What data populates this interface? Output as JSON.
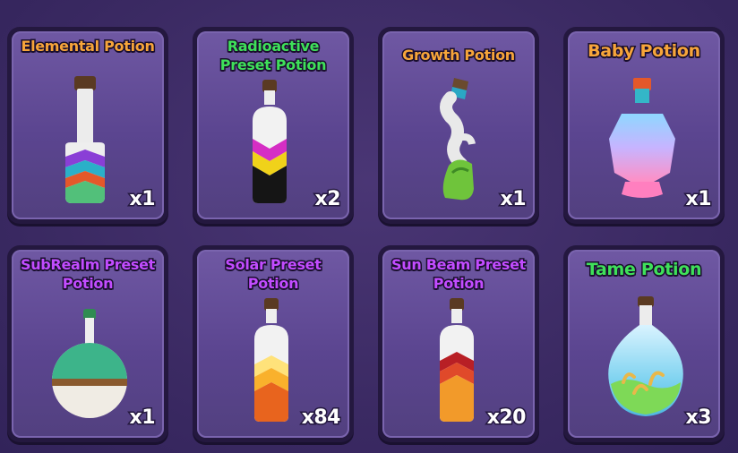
{
  "colors": {
    "panel_bg": "#3b2a63",
    "card_bg": "#5b4590",
    "name_orange": "#f7a53a",
    "name_green": "#3fe05a",
    "name_purple": "#c24cff"
  },
  "inventory": {
    "items": [
      {
        "name": "Elemental Potion",
        "quantity": "x1",
        "name_color": "#f7a53a",
        "icon": "elemental-potion-icon"
      },
      {
        "name": "Radioactive Preset Potion",
        "quantity": "x2",
        "name_color": "#3fe05a",
        "icon": "radioactive-potion-icon"
      },
      {
        "name": "Growth Potion",
        "quantity": "x1",
        "name_color": "#f7a53a",
        "icon": "growth-potion-icon"
      },
      {
        "name": "Baby Potion",
        "quantity": "x1",
        "name_color": "#f7a53a",
        "icon": "baby-potion-icon"
      },
      {
        "name": "SubRealm Preset Potion",
        "quantity": "x1",
        "name_color": "#c24cff",
        "icon": "subrealm-potion-icon"
      },
      {
        "name": "Solar Preset Potion",
        "quantity": "x84",
        "name_color": "#c24cff",
        "icon": "solar-potion-icon"
      },
      {
        "name": "Sun Beam Preset Potion",
        "quantity": "x20",
        "name_color": "#c24cff",
        "icon": "sunbeam-potion-icon"
      },
      {
        "name": "Tame Potion",
        "quantity": "x3",
        "name_color": "#3fe05a",
        "icon": "tame-potion-icon"
      }
    ]
  }
}
